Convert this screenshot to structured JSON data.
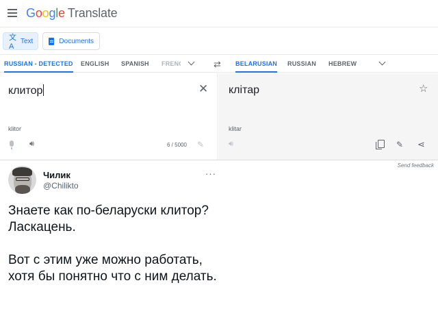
{
  "header": {
    "logo_parts": [
      "G",
      "o",
      "o",
      "g",
      "l",
      "e"
    ],
    "product": "Translate",
    "colors": {
      "blue": "#4285f4",
      "red": "#ea4335",
      "yellow": "#fbbc05",
      "green": "#34a853"
    }
  },
  "modes": {
    "text_label": "Text",
    "documents_label": "Documents"
  },
  "source_languages": [
    "RUSSIAN - DETECTED",
    "ENGLISH",
    "SPANISH",
    "FRENC"
  ],
  "target_languages": [
    "BELARUSIAN",
    "RUSSIAN",
    "HEBREW"
  ],
  "source": {
    "text": "клитор",
    "transliteration": "klitor",
    "char_count": "6 / 5000"
  },
  "target": {
    "text": "клітар",
    "transliteration": "klitar"
  },
  "send_feedback": "Send feedback",
  "tweet": {
    "display_name": "Чилик",
    "handle": "@Chilikto",
    "more": "···",
    "paragraphs": [
      "Знаете как по-беларуски клитор? Ласкацень.",
      "Вот с этим уже можно работать, хотя бы понятно что с ним делать."
    ]
  },
  "icons": {
    "menu": "hamburger-icon",
    "swap": "swap-languages-icon",
    "clear": "close-icon",
    "mic": "microphone-icon",
    "speaker": "speaker-icon",
    "edit": "pencil-icon",
    "star": "star-icon",
    "copy": "copy-icon",
    "share": "share-icon"
  },
  "accent_color": "#1a73e8"
}
